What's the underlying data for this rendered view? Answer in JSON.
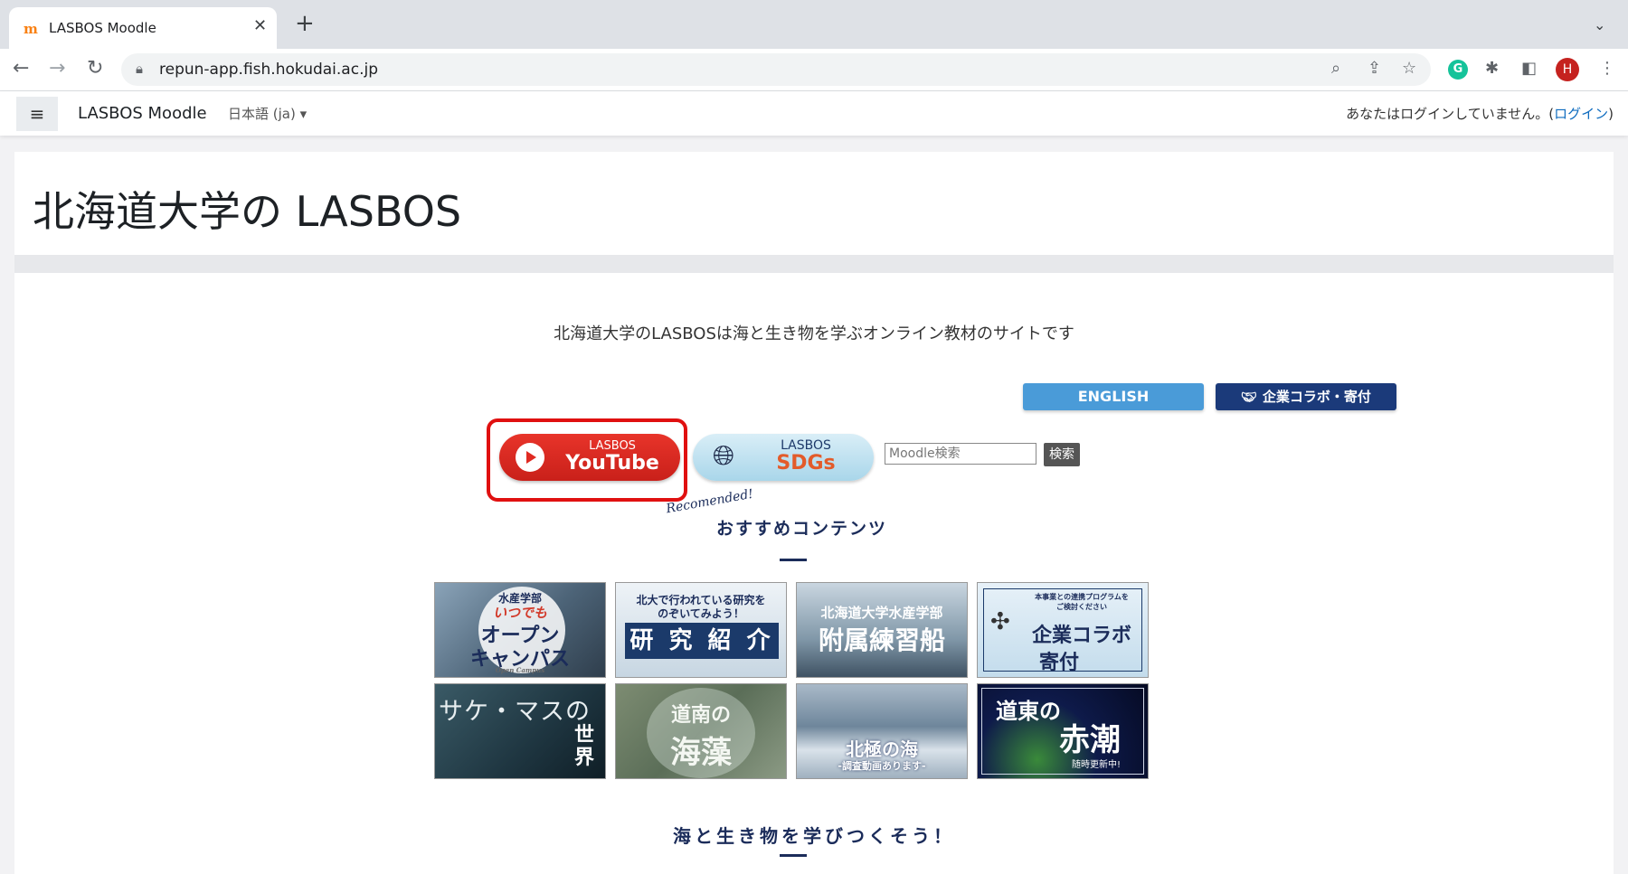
{
  "browser": {
    "tab_title": "LASBOS Moodle",
    "tab_favicon": "m",
    "url": "repun-app.fish.hokudai.ac.jp",
    "profile_initial": "H",
    "grammarly_letter": "G"
  },
  "navbar": {
    "site_name": "LASBOS Moodle",
    "language": "日本語 (ja)",
    "login_status": "あなたはログインしていません。(",
    "login_link": "ログイン",
    "login_close": ")"
  },
  "header": {
    "title": "北海道大学の LASBOS"
  },
  "main": {
    "intro": "北海道大学のLASBOSは海と生き物を学ぶオンライン教材のサイトです",
    "english_button": "ENGLISH",
    "collab_button": "企業コラボ・寄付",
    "youtube": {
      "small": "LASBOS",
      "big": "YouTube"
    },
    "sdgs": {
      "small": "LASBOS",
      "big": "SDGs"
    },
    "search": {
      "placeholder": "Moodle検索",
      "button": "検索"
    },
    "recommended_script": "Recomended!",
    "recommended_title": "おすすめコンテンツ",
    "tiles": [
      {
        "line1": "水産学部",
        "line2": "いつでも",
        "line3": "オープン",
        "line4": "キャンパス",
        "line5": "Open Campus"
      },
      {
        "line1": "北大で行われている研究を",
        "line2": "のぞいてみよう！",
        "line3": "研 究 紹 介"
      },
      {
        "line1": "北海道大学水産学部",
        "line2": "附属練習船"
      },
      {
        "line1": "本事業との連携プログラムを",
        "line2": "ご検討ください",
        "line3": "企業コラボ",
        "line4": "寄付"
      },
      {
        "line1": "サケ・マスの",
        "line2": "世界"
      },
      {
        "line1": "道南の",
        "line2": "海藻"
      },
      {
        "line1": "北極の海",
        "line2": "-調査動画あります-"
      },
      {
        "line1": "道東の",
        "line2": "赤潮",
        "line3": "随時更新中!"
      }
    ],
    "bottom_title": "海と生き物を学びつくそう！"
  },
  "colors": {
    "accent_navy": "#1b2c5a",
    "youtube_red": "#e8342a",
    "english_blue": "#4a9bd8",
    "highlight_red": "#e01010"
  }
}
